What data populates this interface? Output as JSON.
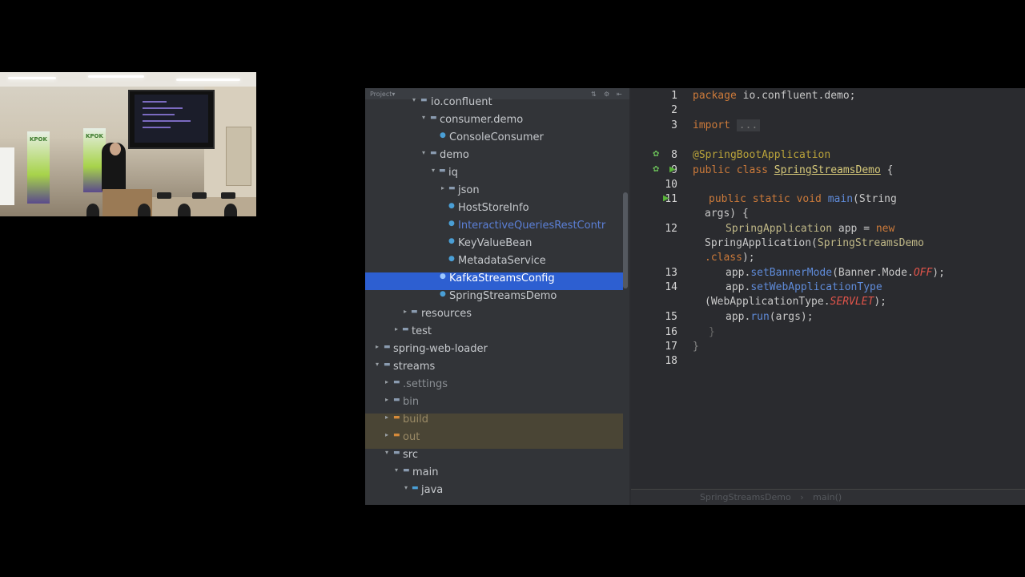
{
  "project_panel": {
    "header_title": "Project",
    "tree": [
      {
        "label": "io.confluent",
        "icon": "package-folder-icon",
        "state": "expanded"
      },
      {
        "label": "consumer.demo",
        "icon": "package-folder-icon",
        "state": "expanded"
      },
      {
        "label": "ConsoleConsumer",
        "icon": "class-icon",
        "state": "leaf"
      },
      {
        "label": "demo",
        "icon": "package-folder-icon",
        "state": "expanded"
      },
      {
        "label": "iq",
        "icon": "package-folder-icon",
        "state": "expanded"
      },
      {
        "label": "json",
        "icon": "package-folder-icon",
        "state": "collapsed"
      },
      {
        "label": "HostStoreInfo",
        "icon": "class-icon",
        "state": "leaf"
      },
      {
        "label": "InteractiveQueriesRestContr",
        "icon": "class-icon",
        "state": "leaf"
      },
      {
        "label": "KeyValueBean",
        "icon": "class-icon",
        "state": "leaf"
      },
      {
        "label": "MetadataService",
        "icon": "class-icon",
        "state": "leaf"
      },
      {
        "label": "KafkaStreamsConfig",
        "icon": "class-icon",
        "state": "selected"
      },
      {
        "label": "SpringStreamsDemo",
        "icon": "class-icon",
        "state": "leaf"
      },
      {
        "label": "resources",
        "icon": "folder-icon",
        "state": "collapsed"
      },
      {
        "label": "test",
        "icon": "folder-icon",
        "state": "collapsed"
      },
      {
        "label": "spring-web-loader",
        "icon": "module-folder-icon",
        "state": "collapsed"
      },
      {
        "label": "streams",
        "icon": "module-folder-icon",
        "state": "expanded"
      },
      {
        "label": ".settings",
        "icon": "folder-icon",
        "state": "collapsed"
      },
      {
        "label": "bin",
        "icon": "folder-icon",
        "state": "collapsed"
      },
      {
        "label": "build",
        "icon": "excluded-folder-icon",
        "state": "collapsed"
      },
      {
        "label": "out",
        "icon": "excluded-folder-icon",
        "state": "collapsed"
      },
      {
        "label": "src",
        "icon": "folder-icon",
        "state": "expanded"
      },
      {
        "label": "main",
        "icon": "folder-icon",
        "state": "expanded"
      },
      {
        "label": "java",
        "icon": "source-folder-icon",
        "state": "expanded"
      }
    ]
  },
  "editor": {
    "line_numbers": [
      "1",
      "2",
      "3",
      "",
      "8",
      "9",
      "10",
      "11",
      "",
      "12",
      "",
      "",
      "13",
      "14",
      "",
      "15",
      "16",
      "17",
      "18"
    ],
    "code": {
      "l1_kw": "package",
      "l1_rest": " io.confluent.demo;",
      "l3_kw": "import",
      "l3_fold": "...",
      "l8_ann": "@SpringBootApplication",
      "l9_kw": "public class ",
      "l9_cls": "SpringStreamsDemo",
      "l9_rest": " {",
      "l11_kw": "public static void ",
      "l11_fn": "main",
      "l11_rest": "(String",
      "l11b": "args) {",
      "l12_type": "SpringApplication",
      "l12_mid": " app = ",
      "l12_kw": "new",
      "l12b_a": "SpringApplication(",
      "l12b_b": "SpringStreamsDemo",
      "l12c_kw": ".class",
      "l12c_rest": ");",
      "l13_a": "app.",
      "l13_fn": "setBannerMode",
      "l13_b": "(Banner.Mode.",
      "l13_enum": "OFF",
      "l13_c": ");",
      "l14_a": "app.",
      "l14_fn": "setWebApplicationType",
      "l14b_a": "(WebApplicationType.",
      "l14b_enum": "SERVLET",
      "l14b_b": ");",
      "l15_a": "app.",
      "l15_fn": "run",
      "l15_b": "(args);",
      "l16": "}",
      "l17": "}"
    }
  },
  "breadcrumb": {
    "class": "SpringStreamsDemo",
    "separator": "›",
    "method": "main()"
  }
}
